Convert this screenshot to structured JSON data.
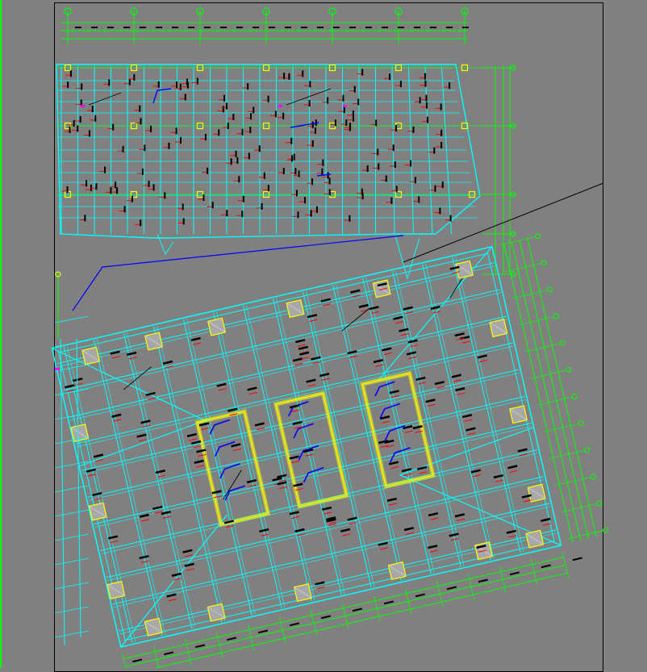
{
  "drawing": {
    "background": "#808080",
    "colors": {
      "beam": "#00ffff",
      "grid": "#00ff00",
      "column": "#ffff00",
      "rebar": "#ff0000",
      "core": "#0000ff",
      "label": "#000000",
      "mark": "#ff00ff"
    },
    "upper_block": {
      "column_count_top": 7,
      "column_rows": 3,
      "bay_count": 6
    },
    "tower_block": {
      "rotation_deg": -13,
      "core_walls": 3,
      "bay_count": 7
    }
  }
}
